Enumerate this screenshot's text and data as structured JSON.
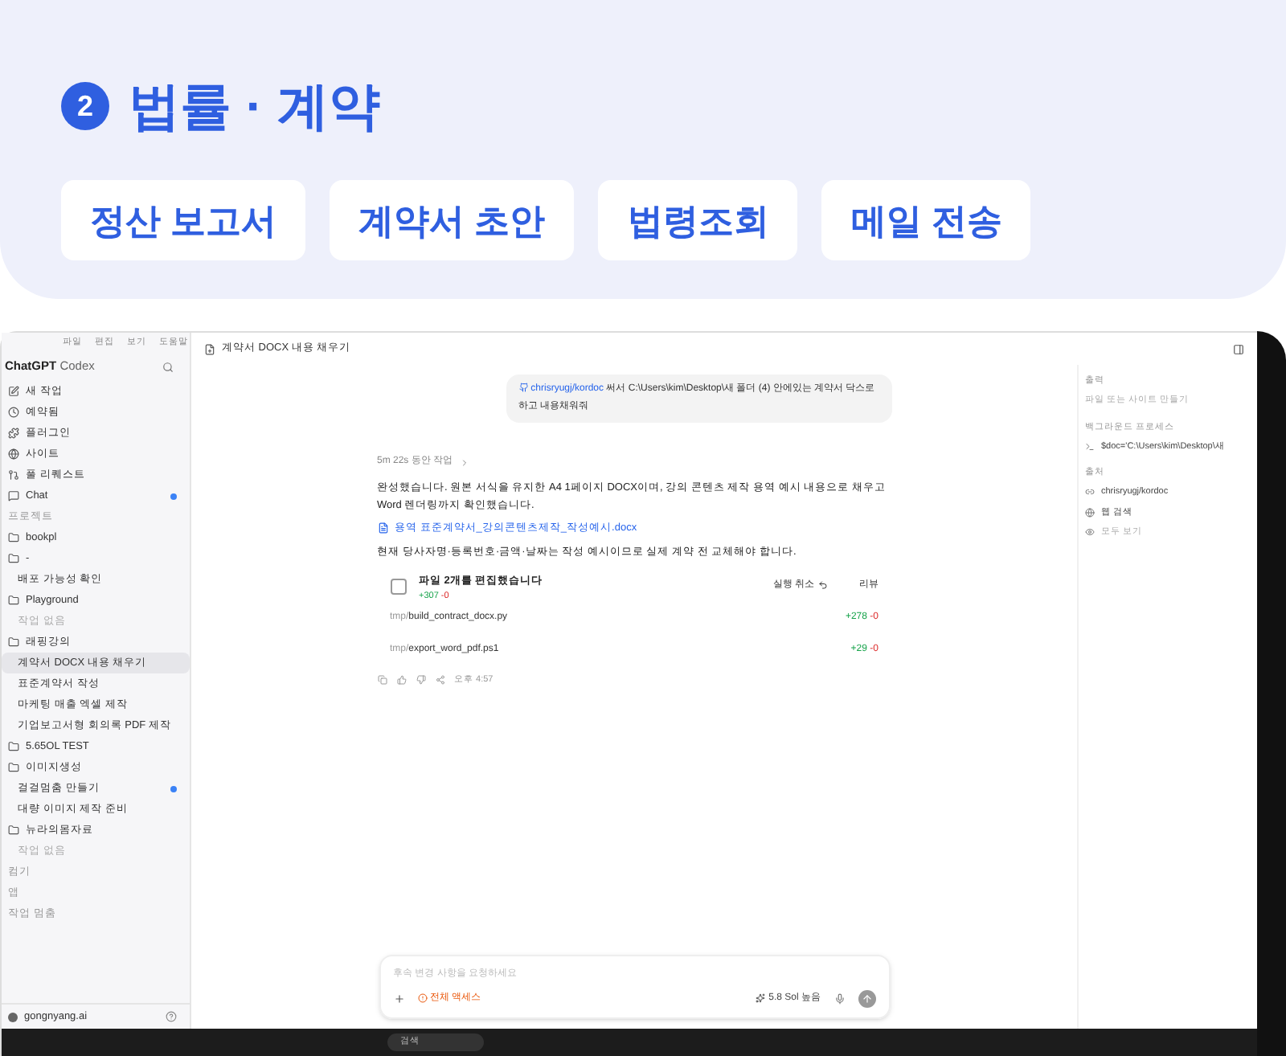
{
  "header": {
    "number": "2",
    "title": "법률 · 계약"
  },
  "tags": [
    "정산 보고서",
    "계약서 초안",
    "법령조회",
    "메일 전송"
  ],
  "app": {
    "menu": [
      "파일",
      "편집",
      "보기",
      "도움말"
    ],
    "sidebar": {
      "brand": "ChatGPT",
      "brand_sub": "Codex",
      "items": [
        {
          "label": "새 작업",
          "kind": "nav",
          "selected": false,
          "unread": false
        },
        {
          "label": "예약됨",
          "kind": "nav",
          "selected": false,
          "unread": false
        },
        {
          "label": "플러그인",
          "kind": "nav",
          "selected": false,
          "unread": false
        },
        {
          "label": "사이트",
          "kind": "nav",
          "selected": false,
          "unread": false
        },
        {
          "label": "풀 리퀘스트",
          "kind": "nav",
          "selected": false,
          "unread": false
        },
        {
          "label": "Chat",
          "kind": "nav",
          "selected": false,
          "unread": true
        },
        {
          "label": "프로젝트",
          "kind": "section",
          "selected": false,
          "unread": false
        },
        {
          "label": "bookpl",
          "kind": "folder",
          "selected": false,
          "unread": false
        },
        {
          "label": "-",
          "kind": "folder",
          "selected": false,
          "unread": false
        },
        {
          "label": "배포 가능성 확인",
          "kind": "thread",
          "selected": false,
          "unread": false
        },
        {
          "label": "Playground",
          "kind": "folder",
          "selected": false,
          "unread": false
        },
        {
          "label": "작업 없음",
          "kind": "empty",
          "selected": false,
          "unread": false
        },
        {
          "label": "래핑강의",
          "kind": "folder",
          "selected": false,
          "unread": false
        },
        {
          "label": "계약서 DOCX 내용 채우기",
          "kind": "thread",
          "selected": true,
          "unread": false
        },
        {
          "label": "표준계약서 작성",
          "kind": "thread",
          "selected": false,
          "unread": false
        },
        {
          "label": "마케팅 매출 엑셀 제작",
          "kind": "thread",
          "selected": false,
          "unread": false
        },
        {
          "label": "기업보고서형 회의록 PDF 제작",
          "kind": "thread",
          "selected": false,
          "unread": false
        },
        {
          "label": "5.65OL TEST",
          "kind": "folder",
          "selected": false,
          "unread": false
        },
        {
          "label": "이미지생성",
          "kind": "folder",
          "selected": false,
          "unread": false
        },
        {
          "label": "걸걸멈춤 만들기",
          "kind": "thread",
          "selected": false,
          "unread": true
        },
        {
          "label": "대량 이미지 제작 준비",
          "kind": "thread",
          "selected": false,
          "unread": false
        },
        {
          "label": "뉴라의몸자료",
          "kind": "folder",
          "selected": false,
          "unread": false
        },
        {
          "label": "작업 없음",
          "kind": "empty",
          "selected": false,
          "unread": false
        },
        {
          "label": "컴기",
          "kind": "section",
          "selected": false,
          "unread": false
        },
        {
          "label": "앱",
          "kind": "section",
          "selected": false,
          "unread": false
        },
        {
          "label": "작업 멈춤",
          "kind": "section",
          "selected": false,
          "unread": false
        }
      ],
      "footer": "gongnyang.ai"
    },
    "thread_title": "계약서 DOCX 내용 채우기",
    "user_message": {
      "repo": "chrisryugj/kordoc",
      "text": "써서 C:\\Users\\kim\\Desktop\\새 폴더 (4) 안에있는 계약서 닥스로 하고 내용채워줘"
    },
    "worked": "5m 22s 동안 작업",
    "reply": "완성했습니다. 원본 서식을 유지한 A4 1페이지 DOCX이며, 강의 콘텐츠 제작 용역 예시 내용으로 채우고 Word 렌더링까지 확인했습니다.",
    "file_link": "용역 표준계약서_강의콘텐츠제작_작성예시.docx",
    "note": "현재 당사자명·등록번호·금액·날짜는 작성 예시이므로 실제 계약 전 교체해야 합니다.",
    "edits": {
      "title": "파일 2개를 편집했습니다",
      "added": "+307",
      "removed": "-0",
      "undo": "실행 취소",
      "review": "리뷰",
      "files": [
        {
          "dir": "tmp/",
          "name": "build_contract_docx.py",
          "added": "+278",
          "removed": "-0"
        },
        {
          "dir": "tmp/",
          "name": "export_word_pdf.ps1",
          "added": "+29",
          "removed": "-0"
        }
      ]
    },
    "time": "오후 4:57",
    "composer": {
      "placeholder": "후속 변경 사항을 요청하세요",
      "access": "전체 액세스",
      "model": "5.8 Sol 높음"
    },
    "right_panel": {
      "sections": [
        {
          "title": "출력",
          "rows": [
            {
              "kind": "hint",
              "label": "파일 또는 사이트 만들기"
            }
          ]
        },
        {
          "title": "백그라운드 프로세스",
          "rows": [
            {
              "kind": "process",
              "label": "$doc='C:\\Users\\kim\\Desktop\\새"
            }
          ]
        },
        {
          "title": "출처",
          "rows": [
            {
              "kind": "link",
              "label": "chrisryugj/kordoc"
            },
            {
              "kind": "web",
              "label": "웹 검색"
            },
            {
              "kind": "more",
              "label": "모두 보기"
            }
          ]
        }
      ]
    },
    "taskbar": {
      "search": "검색"
    }
  }
}
